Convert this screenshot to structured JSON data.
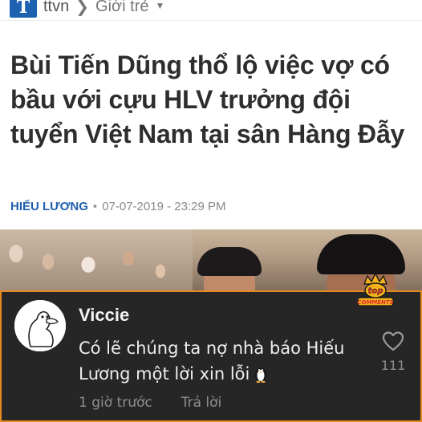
{
  "article": {
    "site_logo_letter": "T",
    "site_name": "ttvn",
    "breadcrumb_separator": "❯",
    "section": "Giới trẻ",
    "headline": "Bùi Tiến Dũng thổ lộ việc vợ có bầu với cựu HLV trưởng đội tuyển Việt Nam tại sân Hàng Đẫy",
    "author": "HIẾU LƯƠNG",
    "datetime": "07-07-2019 - 23:29 PM"
  },
  "comment": {
    "username": "Viccie",
    "text": "Có lẽ chúng ta nợ nhà báo Hiếu Lương một lời xin lỗi",
    "time_ago": "1 giờ trước",
    "reply_label": "Trả lời",
    "like_count": "111"
  },
  "watermark": {
    "line1": "top",
    "line2": "COMMENTS"
  },
  "colors": {
    "brand_blue": "#1d62b0",
    "author_blue": "#1f5fae",
    "card_background": "#262626",
    "card_border": "#e58a1f"
  },
  "icons": [
    "site-logo-icon",
    "chevron-down-icon",
    "duck-avatar-icon",
    "heart-icon",
    "penguin-emoji-icon",
    "crown-icon"
  ]
}
